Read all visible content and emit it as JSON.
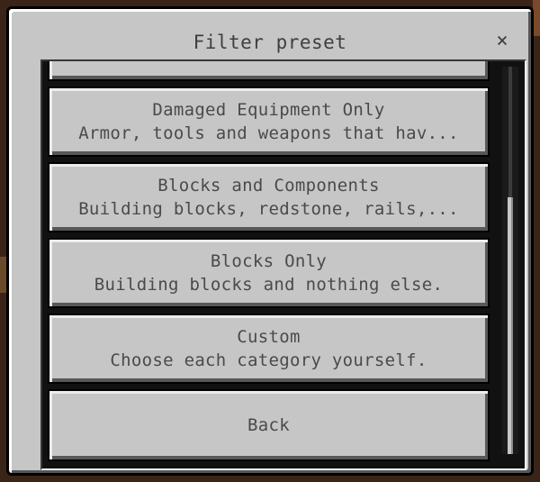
{
  "dialog": {
    "title": "Filter preset",
    "close_glyph": "×"
  },
  "presets": [
    {
      "name": "",
      "description": ""
    },
    {
      "name": "Damaged Equipment Only",
      "description": "Armor, tools and weapons that hav..."
    },
    {
      "name": "Blocks and Components",
      "description": "Building blocks, redstone, rails,..."
    },
    {
      "name": "Blocks Only",
      "description": "Building blocks and nothing else."
    },
    {
      "name": "Custom",
      "description": "Choose each category yourself."
    }
  ],
  "back_label": "Back",
  "colors": {
    "panel": "#c6c6c6",
    "text": "#4a4a4a",
    "list_bg": "#111111"
  }
}
